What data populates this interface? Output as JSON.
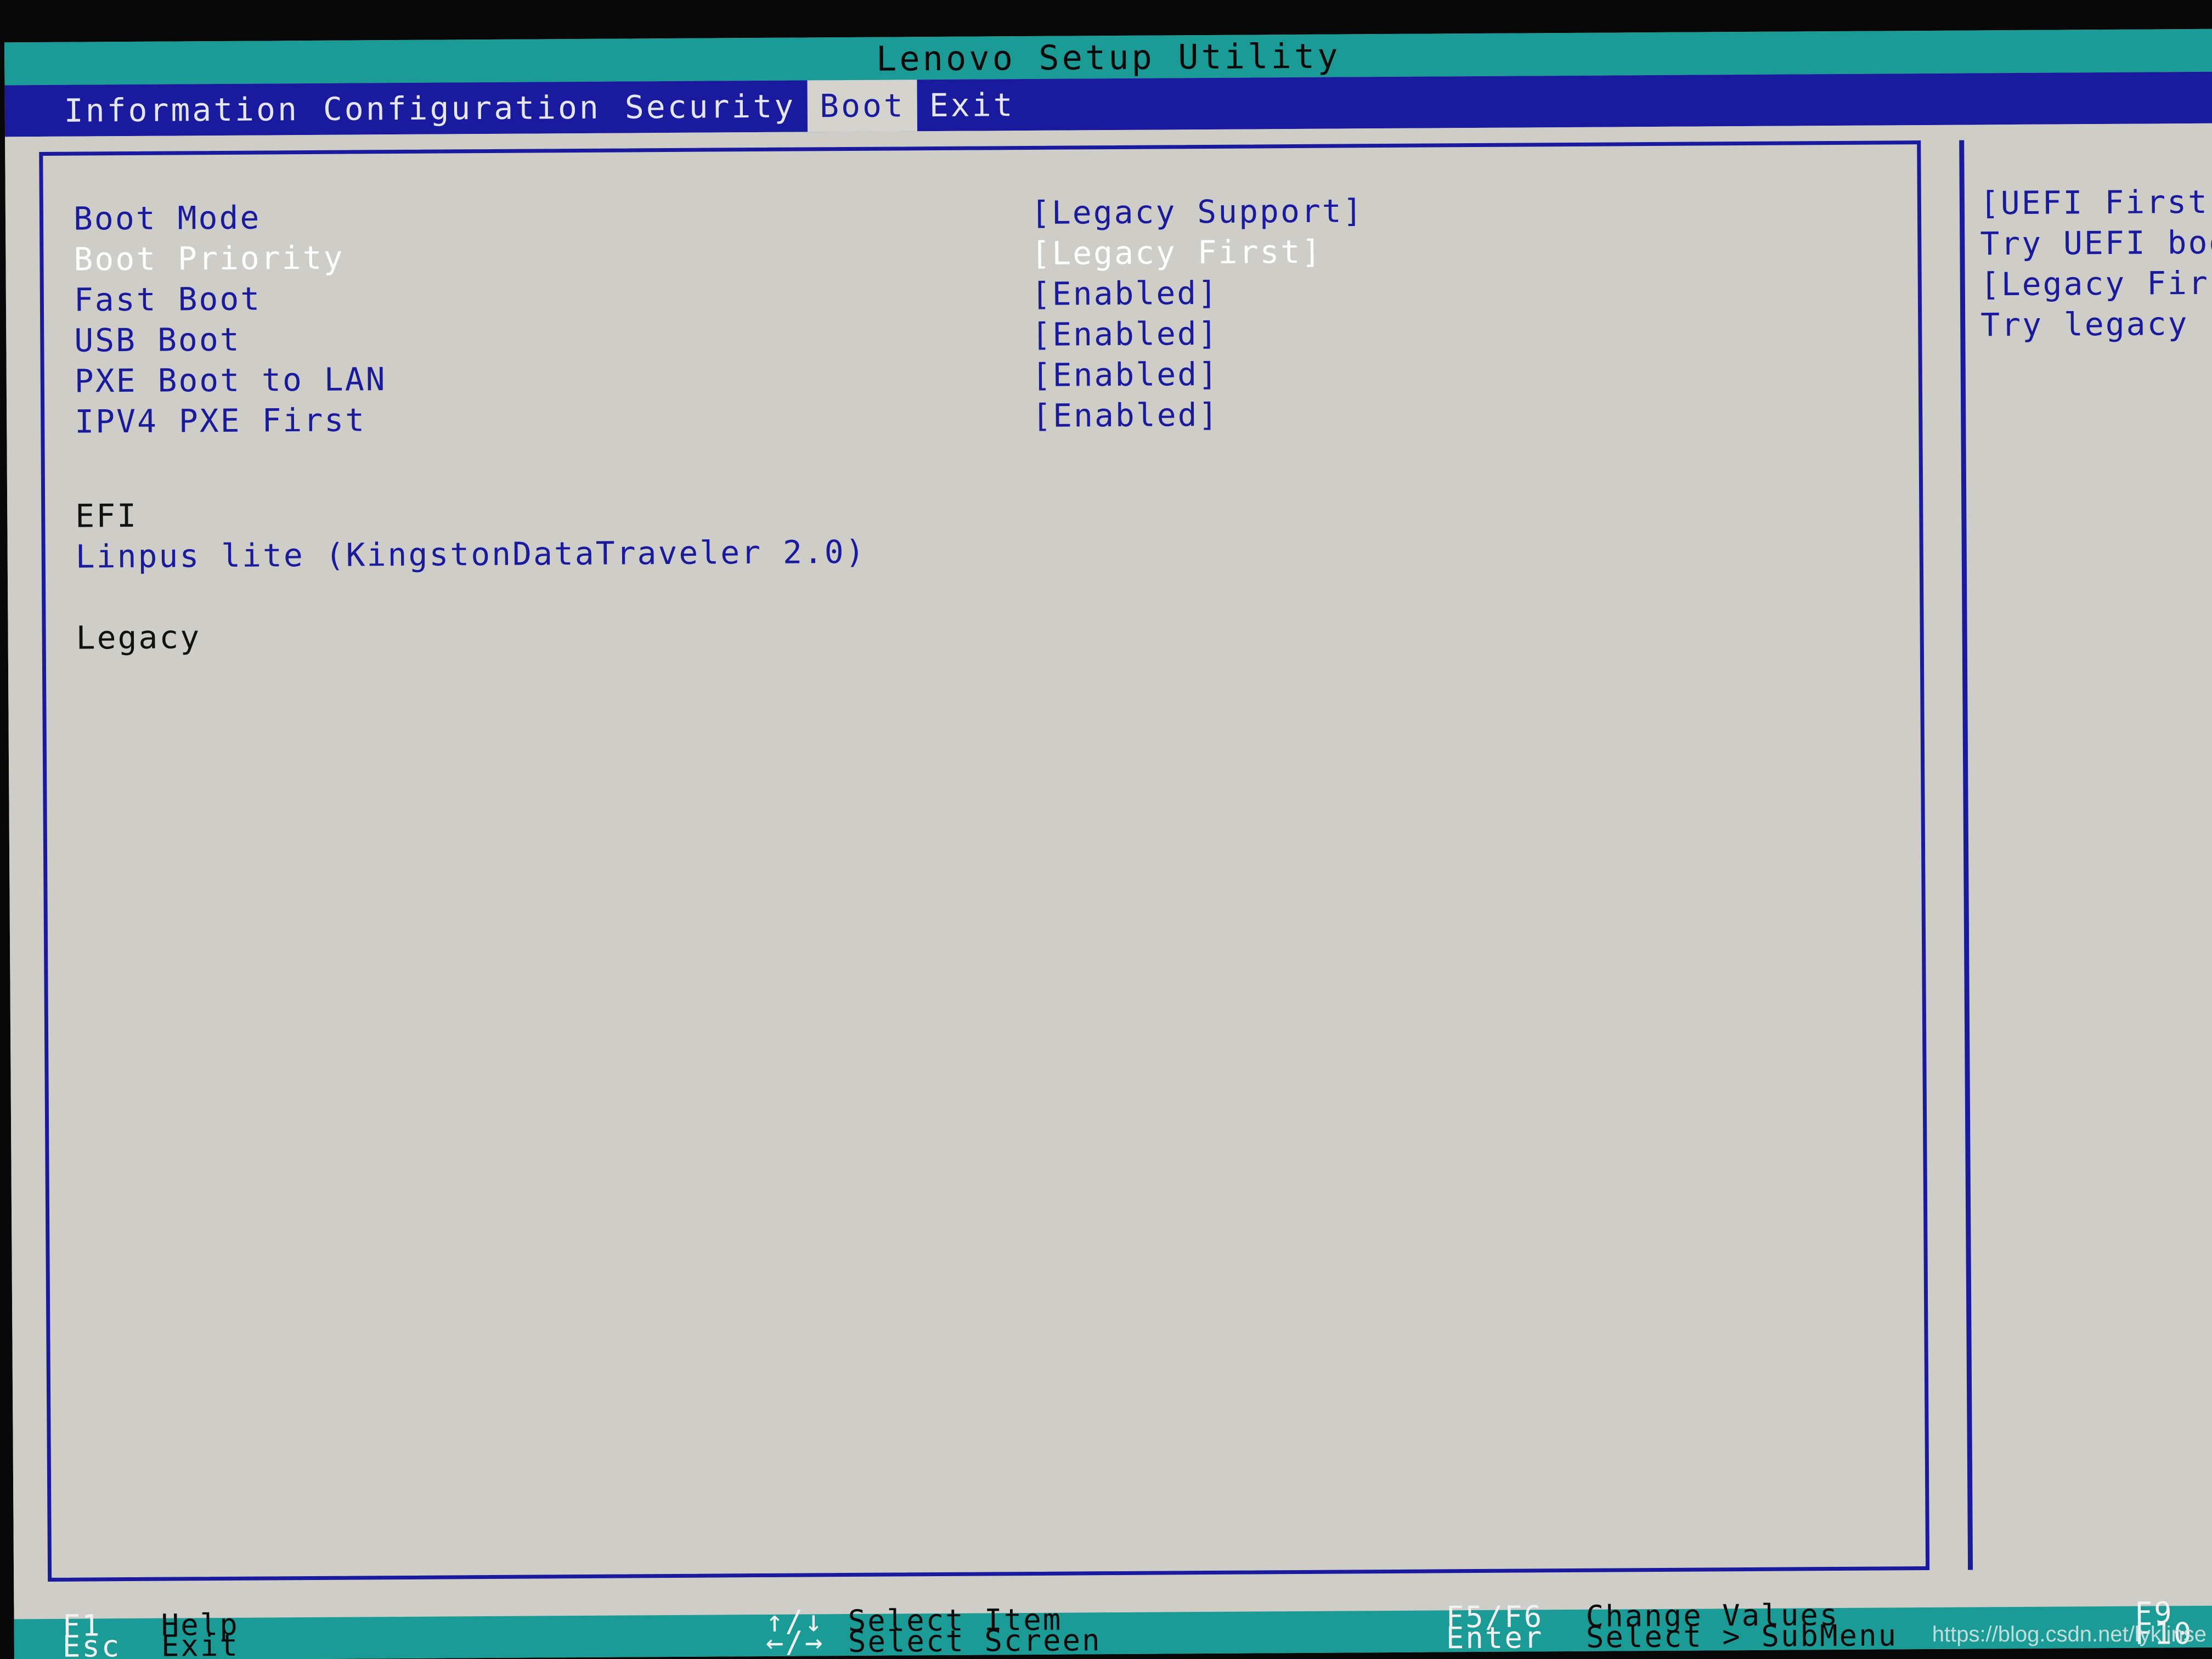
{
  "colors": {
    "title_bar": "#1b9b96",
    "menu_bar": "#1a1a9e",
    "panel_bg": "#cfcdc8",
    "accent_blue": "#1a1a9e",
    "selected_text": "#ffffff",
    "footer_bar": "#1b9b96",
    "header_text": "#111111"
  },
  "titlebar": {
    "title": "Lenovo Setup Utility"
  },
  "menubar": {
    "items": [
      {
        "label": "Information",
        "active": false
      },
      {
        "label": "Configuration",
        "active": false
      },
      {
        "label": "Security",
        "active": false
      },
      {
        "label": "Boot",
        "active": true
      },
      {
        "label": "Exit",
        "active": false
      }
    ]
  },
  "main": {
    "settings": [
      {
        "label": "Boot Mode",
        "value": "[Legacy Support]",
        "selected": false
      },
      {
        "label": "Boot Priority",
        "value": "[Legacy First]",
        "selected": true
      },
      {
        "label": "Fast Boot",
        "value": "[Enabled]",
        "selected": false
      },
      {
        "label": "USB Boot",
        "value": "[Enabled]",
        "selected": false
      },
      {
        "label": "PXE Boot to LAN",
        "value": "[Enabled]",
        "selected": false
      },
      {
        "label": "IPV4 PXE First",
        "value": "[Enabled]",
        "selected": false
      }
    ],
    "device_groups": [
      {
        "header": "EFI",
        "entries": [
          "Linpus lite (KingstonDataTraveler 2.0)"
        ]
      },
      {
        "header": "Legacy",
        "entries": []
      }
    ]
  },
  "help_panel": {
    "lines": [
      "[UEFI First]",
      "Try UEFI boot",
      "[Legacy First]",
      "Try legacy boot"
    ]
  },
  "footer": {
    "row1": [
      {
        "key": "F1",
        "action": "Help",
        "col": 1
      },
      {
        "key": "↑/↓",
        "action": "Select Item",
        "col": 2
      },
      {
        "key": "F5/F6",
        "action": "Change Values",
        "col": 3
      },
      {
        "key": "F9",
        "action": "",
        "col": 4
      }
    ],
    "row2": [
      {
        "key": "Esc",
        "action": "Exit",
        "col": 1
      },
      {
        "key": "←/→",
        "action": "Select Screen",
        "col": 2
      },
      {
        "key": "Enter",
        "action": "Select > SubMenu",
        "col": 3
      },
      {
        "key": "F10",
        "action": "",
        "col": 4
      }
    ]
  },
  "watermark": {
    "text": "https://blog.csdn.net/lyklinse"
  }
}
